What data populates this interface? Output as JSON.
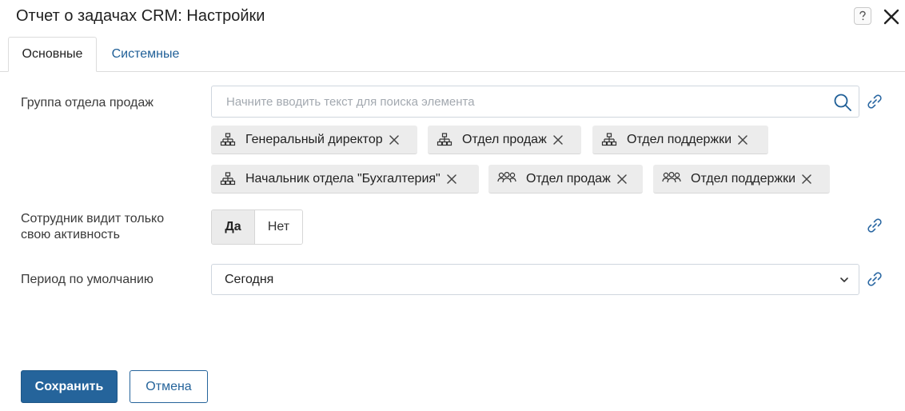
{
  "dialog": {
    "title": "Отчет о задачах CRM: Настройки",
    "help_icon": "question-icon",
    "close_icon": "close-icon"
  },
  "tabs": [
    {
      "label": "Основные",
      "active": true
    },
    {
      "label": "Системные",
      "active": false
    }
  ],
  "fields": {
    "sales_group": {
      "label": "Группа отдела продаж",
      "placeholder": "Начните вводить текст для поиска элемента",
      "chips": [
        {
          "label": "Генеральный директор",
          "icon": "org-structure-icon"
        },
        {
          "label": "Отдел продаж",
          "icon": "org-structure-icon"
        },
        {
          "label": "Отдел поддержки",
          "icon": "org-structure-icon"
        },
        {
          "label": "Начальник отдела \"Бухгалтерия\"",
          "icon": "org-structure-icon"
        },
        {
          "label": "Отдел продаж",
          "icon": "group-users-icon"
        },
        {
          "label": "Отдел поддержки",
          "icon": "group-users-icon"
        }
      ]
    },
    "own_activity": {
      "label": "Сотрудник видит только свою активность",
      "yes": "Да",
      "no": "Нет",
      "selected": "Да"
    },
    "default_period": {
      "label": "Период по умолчанию",
      "value": "Сегодня"
    }
  },
  "buttons": {
    "save": "Сохранить",
    "cancel": "Отмена"
  },
  "colors": {
    "primary": "#25649b",
    "tab_link": "#1f5f97",
    "chip_bg": "#ececec"
  }
}
